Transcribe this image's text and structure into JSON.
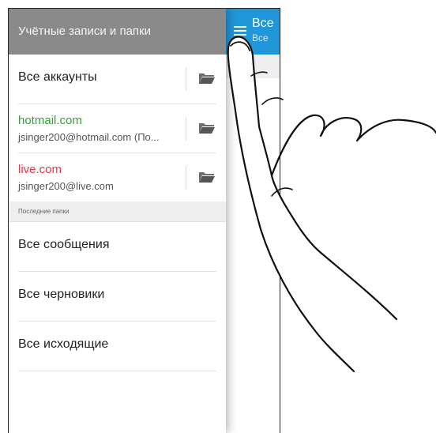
{
  "drawer": {
    "header": "Учётные записи и папки",
    "all_accounts": "Все аккаунты",
    "accounts": [
      {
        "name": "hotmail.com",
        "email": "jsinger200@hotmail.com (По..."
      },
      {
        "name": "live.com",
        "email": "jsinger200@live.com"
      }
    ],
    "section_label": "Последние папки",
    "recent_folders": [
      "Все сообщения",
      "Все черновики",
      "Все исходящие"
    ]
  },
  "main": {
    "title": "Все",
    "subtitle": "Все"
  },
  "colors": {
    "accent": "#2196d9",
    "drawer_header": "#8a8a8a",
    "hotmail": "#3a9d3a",
    "live": "#e8374a"
  }
}
